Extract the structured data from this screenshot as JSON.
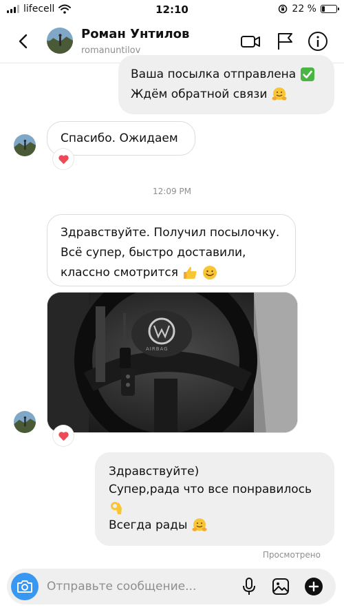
{
  "status_bar": {
    "carrier": "lifecell",
    "time": "12:10",
    "battery": "22 %",
    "battery_level": 0.22
  },
  "header": {
    "name": "Роман Унтилов",
    "username": "romanuntilov"
  },
  "messages": {
    "m1": {
      "lines": [
        "Ваша посылка отправлена",
        "Ждём обратной связи"
      ]
    },
    "m2": {
      "text": "Спасибо. Ожидаем",
      "reaction": "heart"
    },
    "timestamp": "12:09 PM",
    "m3": {
      "lines": [
        "Здравствуйте. Получил посылочку.",
        "Всё супер, быстро доставили,",
        "классно смотрится"
      ]
    },
    "photo": {
      "badge": "AIRBAG",
      "reaction": "heart"
    },
    "m4": {
      "lines": [
        "Здравствуйте)",
        "Супер,рада что все понравилось",
        "Всегда рады"
      ]
    },
    "seen": "Просмотрено"
  },
  "composer": {
    "placeholder": "Отправьте сообщение..."
  },
  "icons": {
    "back": "chevron-left-icon",
    "video": "video-camera-icon",
    "flag": "flag-icon",
    "info": "info-icon",
    "camera": "camera-icon",
    "mic": "microphone-icon",
    "gallery": "gallery-icon",
    "plus": "plus-icon"
  },
  "colors": {
    "accent": "#3897f0",
    "heart": "#ed4956",
    "bubble_out": "#efefef",
    "muted": "#8e8e8e"
  }
}
